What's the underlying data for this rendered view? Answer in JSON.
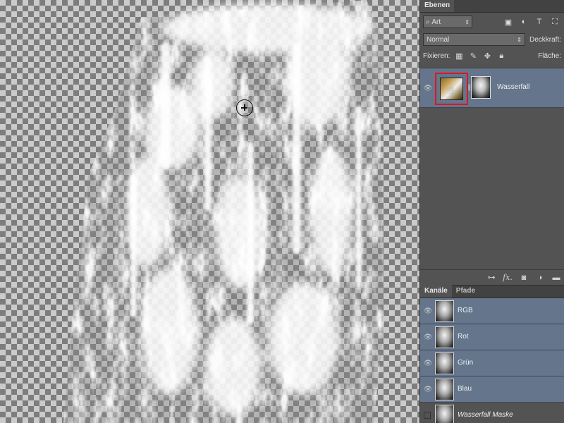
{
  "layers_panel": {
    "tab_label": "Ebenen",
    "filter": {
      "kind": "Art",
      "icons": [
        "image-filter-icon",
        "adjustment-filter-icon",
        "type-filter-icon",
        "shape-filter-icon"
      ]
    },
    "blend_mode": "Normal",
    "opacity_label": "Deckkraft:",
    "lock_label": "Fixieren:",
    "fill_label": "Fläche:",
    "layers": [
      {
        "name": "Wasserfall",
        "selected": true,
        "has_mask": true
      }
    ],
    "footer_icons": [
      "link-icon",
      "fx-icon",
      "mask-icon",
      "adjustment-layer-icon",
      "folder-icon"
    ],
    "fx_text": "fx."
  },
  "channels_panel": {
    "tabs": [
      {
        "label": "Kanäle",
        "active": true
      },
      {
        "label": "Pfade",
        "active": false
      }
    ],
    "channels": [
      {
        "name": "RGB",
        "visible": true
      },
      {
        "name": "Rot",
        "visible": true
      },
      {
        "name": "Grün",
        "visible": true
      },
      {
        "name": "Blau",
        "visible": true
      },
      {
        "name": "Wasserfall Maske",
        "visible": false
      }
    ]
  },
  "colors": {
    "selection_highlight": "#65758c",
    "thumbnail_outline": "#e0141e",
    "panel_bg": "#535353"
  }
}
